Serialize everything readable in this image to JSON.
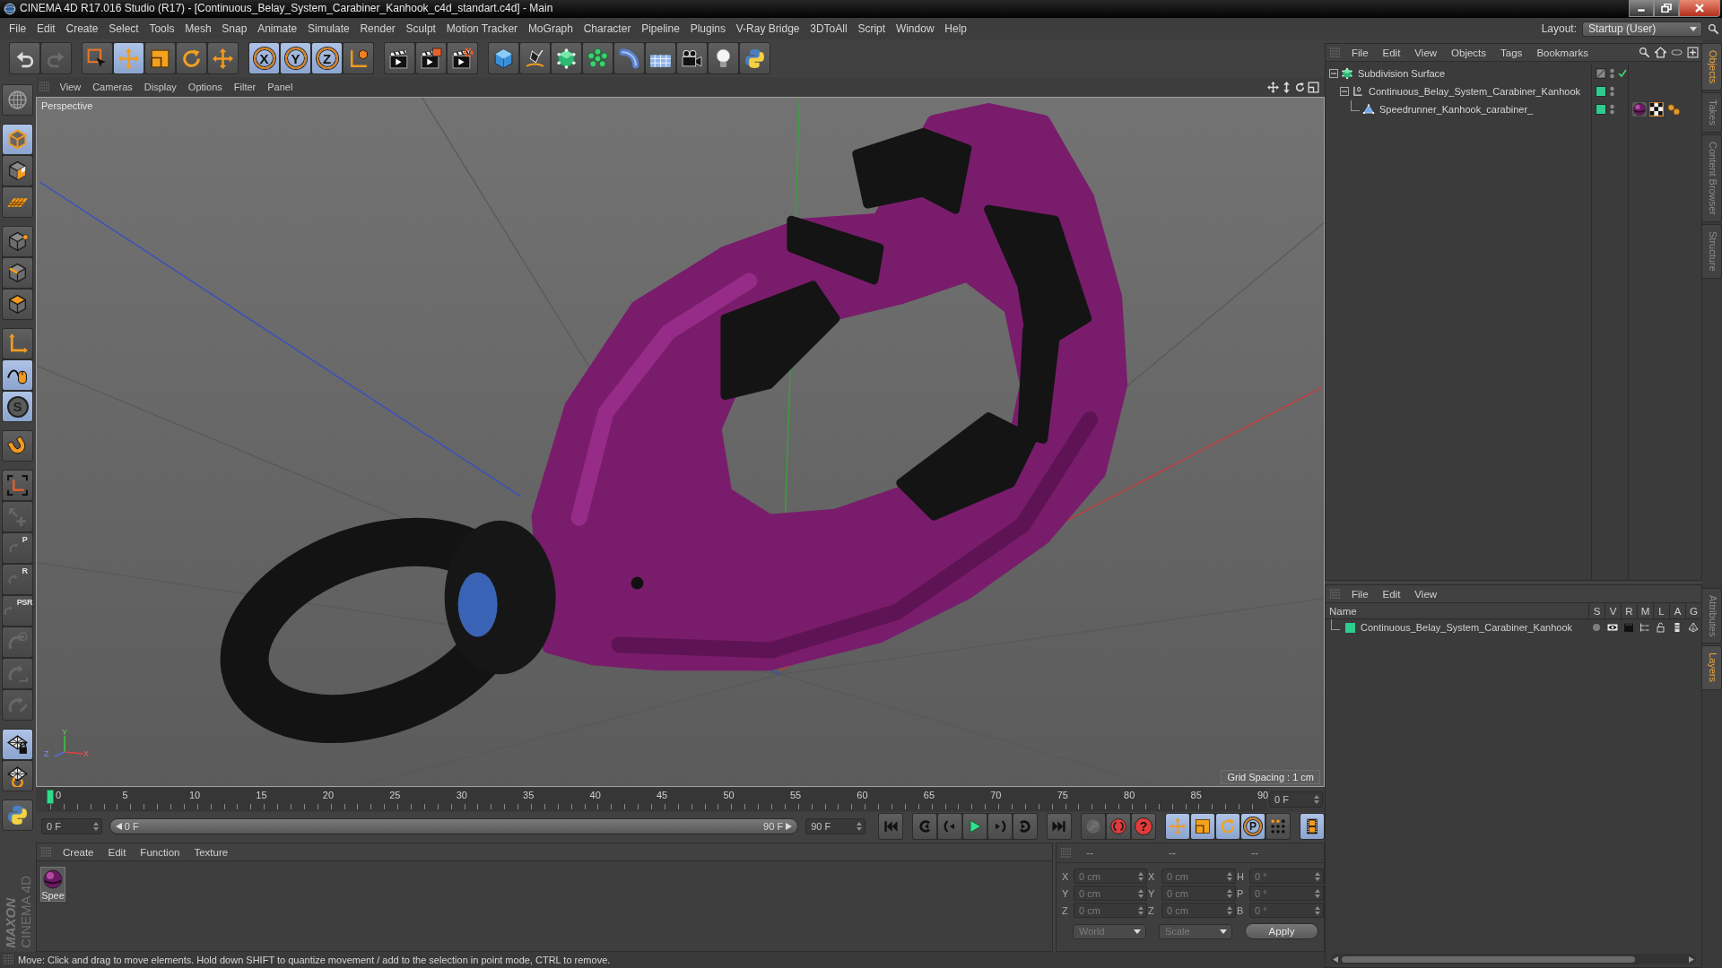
{
  "window": {
    "title": "CINEMA 4D R17.016 Studio (R17) - [Continuous_Belay_System_Carabiner_Kanhook_c4d_standart.c4d] - Main"
  },
  "menu_bar": {
    "items": [
      "File",
      "Edit",
      "Create",
      "Select",
      "Tools",
      "Mesh",
      "Snap",
      "Animate",
      "Simulate",
      "Render",
      "Sculpt",
      "Motion Tracker",
      "MoGraph",
      "Character",
      "Pipeline",
      "Plugins",
      "V-Ray Bridge",
      "3DToAll",
      "Script",
      "Window",
      "Help"
    ],
    "layout_label": "Layout:",
    "layout_value": "Startup (User)"
  },
  "toolbar": {
    "groups": [
      [
        {
          "kind": "undo",
          "selected": false,
          "disabled": false
        },
        {
          "kind": "redo",
          "selected": false,
          "disabled": true
        }
      ],
      [
        {
          "kind": "select",
          "selected": false,
          "disabled": false
        },
        {
          "kind": "move",
          "selected": true,
          "disabled": false
        },
        {
          "kind": "scale",
          "selected": false,
          "disabled": false
        },
        {
          "kind": "rotate",
          "selected": false,
          "disabled": false
        },
        {
          "kind": "recent",
          "selected": false,
          "disabled": false
        }
      ],
      [
        {
          "kind": "axis",
          "glyph": "X",
          "selected": true,
          "disabled": false
        },
        {
          "kind": "axis",
          "glyph": "Y",
          "selected": true,
          "disabled": false
        },
        {
          "kind": "axis",
          "glyph": "Z",
          "selected": true,
          "disabled": false
        },
        {
          "kind": "coords",
          "selected": false,
          "disabled": false
        }
      ],
      [
        {
          "kind": "renderview",
          "selected": false,
          "disabled": false
        },
        {
          "kind": "renderviewer",
          "selected": false,
          "disabled": false
        },
        {
          "kind": "rendersettings",
          "selected": false,
          "disabled": false
        }
      ],
      [
        {
          "kind": "cube",
          "selected": false,
          "disabled": false
        },
        {
          "kind": "pen",
          "selected": false,
          "disabled": false
        },
        {
          "kind": "subdivision",
          "selected": false,
          "disabled": false
        },
        {
          "kind": "cloner",
          "selected": false,
          "disabled": false
        },
        {
          "kind": "deformer",
          "selected": false,
          "disabled": false
        },
        {
          "kind": "floor",
          "selected": false,
          "disabled": false
        },
        {
          "kind": "camera",
          "selected": false,
          "disabled": false
        },
        {
          "kind": "light",
          "selected": false,
          "disabled": false
        },
        {
          "kind": "python",
          "selected": false,
          "disabled": false
        }
      ]
    ]
  },
  "left_toolbar": {
    "groups": [
      [
        {
          "kind": "globe",
          "selected": false,
          "disabled": false
        }
      ],
      [
        {
          "kind": "model",
          "selected": true,
          "disabled": false
        },
        {
          "kind": "texture",
          "selected": false,
          "disabled": false
        },
        {
          "kind": "workplane",
          "selected": false,
          "disabled": false
        }
      ],
      [
        {
          "kind": "points",
          "selected": false,
          "disabled": false
        },
        {
          "kind": "edges",
          "selected": false,
          "disabled": false
        },
        {
          "kind": "polygons",
          "selected": false,
          "disabled": false
        }
      ],
      [
        {
          "kind": "axis3d",
          "selected": false,
          "disabled": false
        },
        {
          "kind": "tweak",
          "selected": true,
          "disabled": false
        },
        {
          "kind": "snap",
          "glyph": "S",
          "selected": true,
          "disabled": false
        }
      ],
      [
        {
          "kind": "magnet",
          "selected": false,
          "disabled": false
        }
      ],
      [
        {
          "kind": "axiscorners",
          "selected": false,
          "disabled": false
        },
        {
          "kind": "moveplus",
          "selected": false,
          "disabled": true
        },
        {
          "kind": "lock",
          "glyph": "P",
          "selected": false,
          "disabled": true
        },
        {
          "kind": "lock",
          "glyph": "R",
          "selected": false,
          "disabled": true
        },
        {
          "kind": "lock",
          "glyph": "PSR",
          "selected": false,
          "disabled": true
        },
        {
          "kind": "lockring",
          "selected": false,
          "disabled": true
        },
        {
          "kind": "lockbox",
          "selected": false,
          "disabled": true
        },
        {
          "kind": "lockpen",
          "selected": false,
          "disabled": true
        }
      ],
      [
        {
          "kind": "gridlock",
          "selected": true,
          "disabled": false
        },
        {
          "kind": "gridrotate",
          "selected": false,
          "disabled": false
        }
      ],
      [
        {
          "kind": "python",
          "selected": false,
          "disabled": false
        }
      ]
    ]
  },
  "viewport": {
    "menu": [
      "View",
      "Cameras",
      "Display",
      "Options",
      "Filter",
      "Panel"
    ],
    "camera": "Perspective",
    "grid_spacing": "Grid Spacing : 1 cm",
    "axis_labels": [
      "Y",
      "Z",
      "X"
    ]
  },
  "timeline": {
    "ticks": [
      "0",
      "5",
      "10",
      "15",
      "20",
      "25",
      "30",
      "35",
      "40",
      "45",
      "50",
      "55",
      "60",
      "65",
      "70",
      "75",
      "80",
      "85",
      "90"
    ],
    "level": 0,
    "current_frame": "0 F"
  },
  "transport": {
    "start_frame": "0 F",
    "range_start": "0 F",
    "range_end": "90 F",
    "end_frame": "90 F",
    "groups": [
      [
        {
          "kind": "first",
          "selected": false,
          "disabled": false
        }
      ],
      [
        {
          "kind": "prevkey",
          "selected": false,
          "disabled": false
        },
        {
          "kind": "prevframe",
          "selected": false,
          "disabled": false
        },
        {
          "kind": "play",
          "selected": false,
          "disabled": false
        },
        {
          "kind": "nextframe",
          "selected": false,
          "disabled": false
        },
        {
          "kind": "nextkey",
          "selected": false,
          "disabled": false
        }
      ],
      [
        {
          "kind": "last",
          "selected": false,
          "disabled": false
        }
      ],
      [
        {
          "kind": "reckey",
          "selected": false,
          "disabled": true
        },
        {
          "kind": "autokey",
          "selected": false,
          "disabled": false
        },
        {
          "kind": "keyselection",
          "glyph": "?",
          "selected": false,
          "disabled": false
        }
      ],
      [
        {
          "kind": "move",
          "selected": true,
          "disabled": false
        },
        {
          "kind": "scale",
          "selected": true,
          "disabled": false
        },
        {
          "kind": "rotate",
          "selected": true,
          "disabled": false
        },
        {
          "kind": "param",
          "glyph": "P",
          "selected": true,
          "disabled": false
        },
        {
          "kind": "pla",
          "selected": false,
          "disabled": false
        }
      ],
      [
        {
          "kind": "timeline",
          "selected": true,
          "disabled": false
        }
      ]
    ]
  },
  "material_manager": {
    "menu": [
      "Create",
      "Edit",
      "Function",
      "Texture"
    ],
    "materials": [
      {
        "name": "Spee"
      }
    ]
  },
  "coordinates": {
    "disabled": true,
    "headers": [
      "--",
      "--",
      "--"
    ],
    "rows": [
      [
        {
          "label": "X",
          "value": "0 cm"
        },
        {
          "label": "X",
          "value": "0 cm"
        },
        {
          "label": "H",
          "value": "0 °"
        }
      ],
      [
        {
          "label": "Y",
          "value": "0 cm"
        },
        {
          "label": "Y",
          "value": "0 cm"
        },
        {
          "label": "P",
          "value": "0 °"
        }
      ],
      [
        {
          "label": "Z",
          "value": "0 cm"
        },
        {
          "label": "Z",
          "value": "0 cm"
        },
        {
          "label": "B",
          "value": "0 °"
        }
      ]
    ],
    "mode": "World",
    "size_mode": "Scale",
    "apply": "Apply"
  },
  "status_bar": {
    "text": "Move: Click and drag to move elements. Hold down SHIFT to quantize movement / add to the selection in point mode, CTRL to remove."
  },
  "object_manager": {
    "menu": [
      "File",
      "Edit",
      "View",
      "Objects",
      "Tags",
      "Bookmarks"
    ],
    "objects": [
      {
        "name": "Subdivision Surface",
        "kind": "subdivision",
        "expanded": true,
        "enabled": true,
        "children": [
          {
            "name": "Continuous_Belay_System_Carabiner_Kanhook",
            "kind": "null",
            "expanded": true,
            "color": "#2ecc8f",
            "children": [
              {
                "name": "Speedrunner_Kanhook_carabiner_",
                "kind": "polygon",
                "color": "#2ecc8f",
                "tags": [
                  {
                    "kind": "material"
                  },
                  {
                    "kind": "texture"
                  },
                  {
                    "kind": "phong"
                  }
                ]
              }
            ]
          }
        ]
      }
    ]
  },
  "layer_manager": {
    "menu": [
      "File",
      "Edit",
      "View"
    ],
    "columns": [
      "Name",
      "S",
      "V",
      "R",
      "M",
      "L",
      "A",
      "G"
    ],
    "layers": [
      {
        "name": "Continuous_Belay_System_Carabiner_Kanhook",
        "color": "#2ecc8f"
      }
    ]
  },
  "side_tabs": {
    "top": [
      {
        "label": "Objects",
        "selected": true
      },
      {
        "label": "Takes",
        "selected": false
      },
      {
        "label": "Content Browser",
        "selected": false
      },
      {
        "label": "Structure",
        "selected": false
      }
    ],
    "bottom": [
      {
        "label": "Attributes",
        "selected": false
      },
      {
        "label": "Layers",
        "selected": true
      }
    ]
  },
  "logo": {
    "brand": "MAXON",
    "product": "CINEMA 4D"
  }
}
